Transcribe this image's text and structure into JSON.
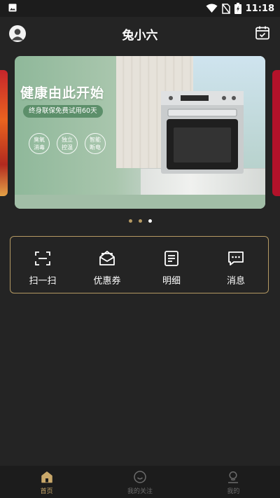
{
  "status_bar": {
    "time": "11:18"
  },
  "header": {
    "title": "兔小六"
  },
  "banner": {
    "headline": "健康由此开始",
    "pill": "终身联保免费试用60天",
    "badges": [
      "臭氧\n消毒",
      "独立\n控温",
      "智能\n断电"
    ]
  },
  "carousel": {
    "pages": 3,
    "active_index": 2
  },
  "actions": [
    {
      "label": "扫一扫",
      "icon": "scan-icon"
    },
    {
      "label": "优惠券",
      "icon": "coupon-icon"
    },
    {
      "label": "明细",
      "icon": "details-icon"
    },
    {
      "label": "消息",
      "icon": "message-icon"
    }
  ],
  "tabs": [
    {
      "label": "首页",
      "icon": "home-icon",
      "active": true
    },
    {
      "label": "我的关注",
      "icon": "follow-icon",
      "active": false
    },
    {
      "label": "我的",
      "icon": "profile-icon",
      "active": false
    }
  ],
  "colors": {
    "background": "#242424",
    "accent_gold": "#b59a63",
    "tab_active": "#c9a86a",
    "tab_inactive": "#6c6c6c"
  }
}
